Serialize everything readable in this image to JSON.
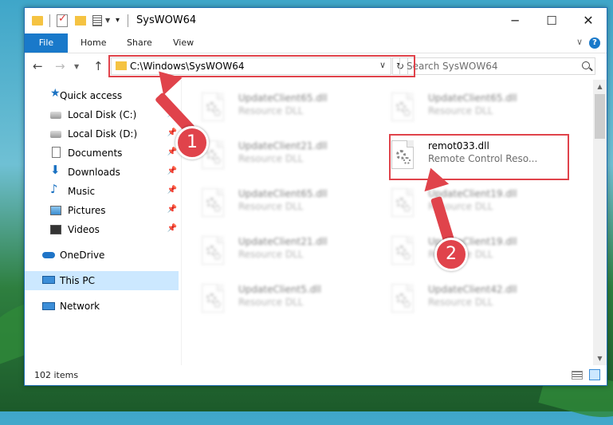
{
  "window": {
    "title": "SysWOW64"
  },
  "ribbon": {
    "tabs": [
      "File",
      "Home",
      "Share",
      "View"
    ]
  },
  "address_bar": {
    "path": "C:\\Windows\\SysWOW64"
  },
  "search": {
    "placeholder": "Search SysWOW64"
  },
  "sidebar": {
    "quick_access": "Quick access",
    "items": [
      {
        "label": "Local Disk (C:)",
        "icon": "disk-icon",
        "pinned": true
      },
      {
        "label": "Local Disk (D:)",
        "icon": "disk-icon",
        "pinned": true
      },
      {
        "label": "Documents",
        "icon": "documents-icon",
        "pinned": true
      },
      {
        "label": "Downloads",
        "icon": "download-arrow-icon",
        "pinned": true
      },
      {
        "label": "Music",
        "icon": "music-note-icon",
        "pinned": true
      },
      {
        "label": "Pictures",
        "icon": "pictures-icon",
        "pinned": true
      },
      {
        "label": "Videos",
        "icon": "film-icon",
        "pinned": true
      }
    ],
    "onedrive": "OneDrive",
    "this_pc": "This PC",
    "network": "Network"
  },
  "files": [
    {
      "name": "UpdateClient65.dll",
      "type": "Resource DLL",
      "blurred": true
    },
    {
      "name": "UpdateClient65.dll",
      "type": "Resource DLL",
      "blurred": true
    },
    {
      "name": "UpdateClient21.dll",
      "type": "Resource DLL",
      "blurred": true
    },
    {
      "name": "remot033.dll",
      "type": "Remote Control Reso...",
      "blurred": false
    },
    {
      "name": "UpdateClient65.dll",
      "type": "Resource DLL",
      "blurred": true
    },
    {
      "name": "UpdateClient19.dll",
      "type": "Resource DLL",
      "blurred": true
    },
    {
      "name": "UpdateClient21.dll",
      "type": "Resource DLL",
      "blurred": true
    },
    {
      "name": "UpdateClient19.dll",
      "type": "Resource DLL",
      "blurred": true
    },
    {
      "name": "UpdateClient5.dll",
      "type": "Resource DLL",
      "blurred": true
    },
    {
      "name": "UpdateClient42.dll",
      "type": "Resource DLL",
      "blurred": true
    }
  ],
  "status": {
    "item_count": "102 items"
  },
  "annotations": {
    "step1": "1",
    "step2": "2",
    "color": "#e0434b"
  },
  "colors": {
    "accent": "#1979ca",
    "selection": "#cce8ff"
  }
}
